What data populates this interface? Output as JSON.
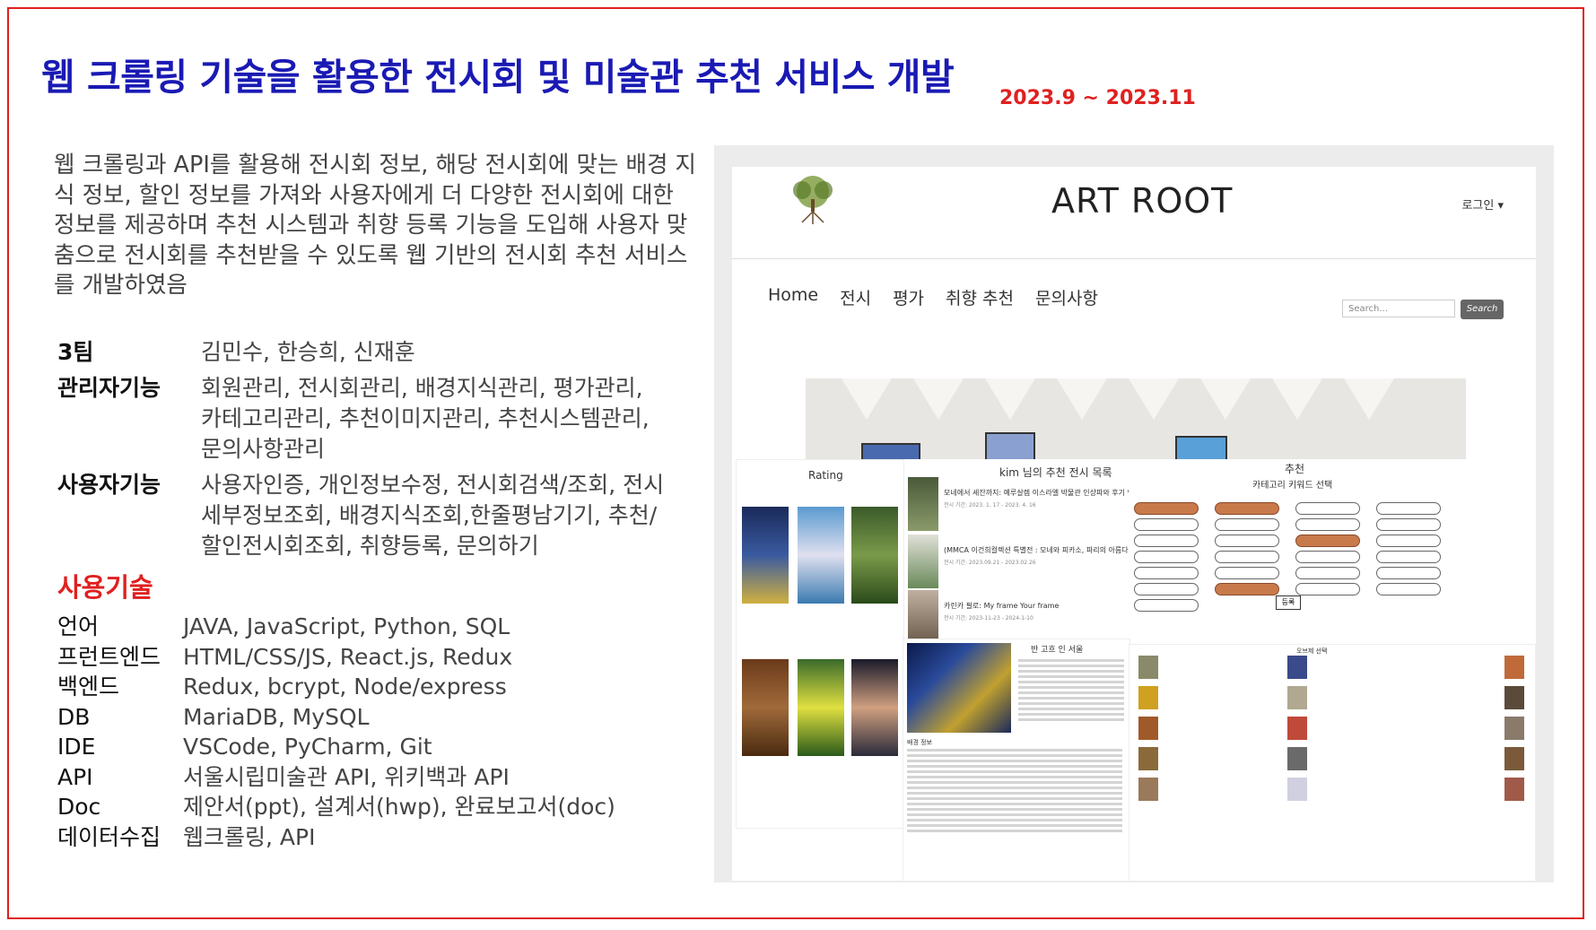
{
  "title": "웹 크롤링 기술을 활용한 전시회 및 미술관 추천 서비스 개발",
  "period": "2023.9 ~ 2023.11",
  "description": "웹 크롤링과 API를 활용해 전시회 정보, 해당 전시회에 맞는 배경 지식 정보, 할인 정보를 가져와 사용자에게 더 다양한 전시회에 대한 정보를 제공하며 추천 시스템과 취향 등록 기능을 도입해 사용자 맞춤으로 전시회를 추천받을 수 있도록 웹 기반의 전시회 추천 서비스를 개발하였음",
  "roles": [
    {
      "key": "3팀",
      "value": "김민수, 한승희, 신재훈"
    },
    {
      "key": "관리자기능",
      "value": "회원관리, 전시회관리, 배경지식관리, 평가관리, 카테고리관리, 추천이미지관리, 추천시스템관리, 문의사항관리"
    },
    {
      "key": "사용자기능",
      "value": "사용자인증, 개인정보수정, 전시회검색/조회, 전시세부정보조회, 배경지식조회,한줄평남기기, 추천/할인전시회조회, 취향등록, 문의하기"
    }
  ],
  "tech_title": "사용기술",
  "techs": [
    {
      "key": "언어",
      "value": "JAVA, JavaScript, Python, SQL"
    },
    {
      "key": "프런트엔드",
      "value": "HTML/CSS/JS, React.js, Redux"
    },
    {
      "key": "백엔드",
      "value": "Redux, bcrypt, Node/express"
    },
    {
      "key": "DB",
      "value": "MariaDB, MySQL"
    },
    {
      "key": "IDE",
      "value": "VSCode, PyCharm, Git"
    },
    {
      "key": "API",
      "value": "서울시립미술관 API, 위키백과 API"
    },
    {
      "key": "Doc",
      "value": "제안서(ppt), 설계서(hwp), 완료보고서(doc)"
    },
    {
      "key": "데이터수집",
      "value": "웹크롤링, API"
    }
  ],
  "site": {
    "logo_text": "ART ROOT",
    "brand": "ART ROOT",
    "login": "로그인 ▾",
    "nav": [
      "Home",
      "전시",
      "평가",
      "취향 추천",
      "문의사항"
    ],
    "search_placeholder": "Search...",
    "search_button": "Search",
    "rating_title": "Rating",
    "reco_title": "kim 님의 추천 전시 목록",
    "reco_items": [
      {
        "title": "모네에서 세잔까지: 예루살렘 이스라엘 박물관 인상파와 후기 인상파 걸작展",
        "sub": "전시 기간: 2023. 1. 17 - 2023. 4. 16"
      },
      {
        "title": "(MMCA 이건희컬렉션 특별전 : 모네와 피카소, 파리의 아름다운 순간들)",
        "sub": "전시 기간: 2023.09.21 - 2023.02.26"
      },
      {
        "title": "카린카 필로: My frame Your frame",
        "sub": "전시 기간: 2023-11-23 - 2024-1-10"
      }
    ],
    "cat_title": "추천",
    "cat_subtitle": "카테고리 키워드 선택",
    "register": "등록",
    "detail_title": "반 고흐 인 서울",
    "detail_label": "배경 정보",
    "picks_title": "오브제 선택"
  },
  "colors": {
    "title": "#1a1ab4",
    "accent": "#e02020",
    "chip_on": "#c87a4a"
  }
}
